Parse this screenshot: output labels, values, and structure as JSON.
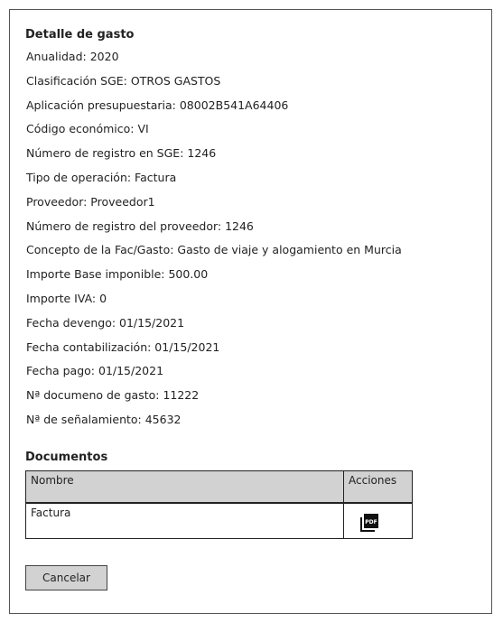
{
  "detail": {
    "title": "Detalle de gasto",
    "fields": [
      "Anualidad: 2020",
      "Clasificación SGE: OTROS GASTOS",
      "Aplicación presupuestaria: 08002B541A64406",
      "Código económico: VI",
      "Número de registro en SGE: 1246",
      "Tipo de operación: Factura",
      "Proveedor: Proveedor1",
      "Número de registro del proveedor: 1246",
      "Concepto de la Fac/Gasto: Gasto de viaje y alogamiento en Murcia",
      "Importe Base imponible: 500.00",
      "Importe IVA: 0",
      "Fecha devengo: 01/15/2021",
      "Fecha contabilización: 01/15/2021",
      "Fecha pago: 01/15/2021",
      "Nª documeno de gasto: 11222",
      "Nª de señalamiento: 45632"
    ]
  },
  "documents": {
    "title": "Documentos",
    "headers": {
      "name": "Nombre",
      "actions": "Acciones"
    },
    "rows": [
      {
        "name": "Factura",
        "action_icon": "pdf-icon"
      }
    ]
  },
  "actions": {
    "cancel_label": "Cancelar"
  },
  "colors": {
    "header_bg": "#d2d2d2",
    "button_bg": "#d2d2d2",
    "border": "#222222"
  }
}
